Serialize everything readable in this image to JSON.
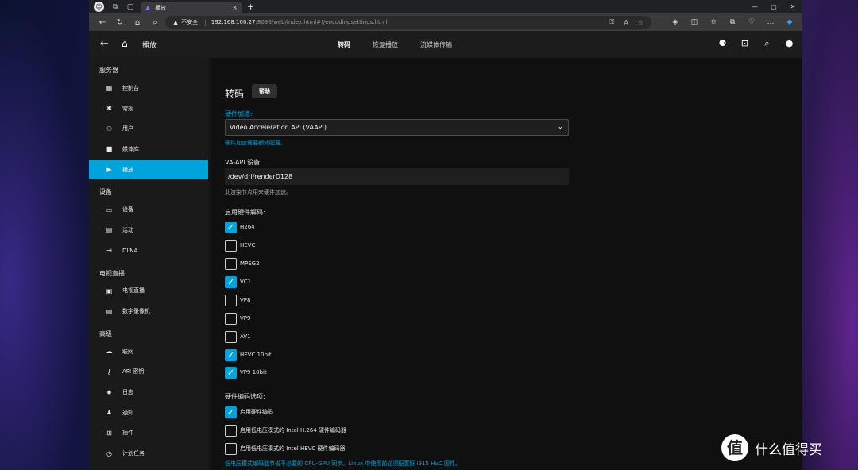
{
  "browser": {
    "tab_title": "播放",
    "new_tab": "+",
    "insecure": "不安全",
    "url_host": "192.168.100.27",
    "url_path": ":8096/web/index.html#!/encodingsettings.html"
  },
  "header": {
    "page_title": "播放",
    "tabs": [
      {
        "label": "转码",
        "active": true
      },
      {
        "label": "恢复播放",
        "active": false
      },
      {
        "label": "流媒体传输",
        "active": false
      }
    ]
  },
  "sidebar": {
    "sections": [
      {
        "title": "服务器",
        "items": [
          {
            "label": "控制台",
            "icon": "dashboard-icon"
          },
          {
            "label": "常规",
            "icon": "gear-icon"
          },
          {
            "label": "用户",
            "icon": "users-icon"
          },
          {
            "label": "媒体库",
            "icon": "folder-icon"
          },
          {
            "label": "播放",
            "icon": "play-icon",
            "active": true
          }
        ]
      },
      {
        "title": "设备",
        "items": [
          {
            "label": "设备",
            "icon": "devices-icon"
          },
          {
            "label": "活动",
            "icon": "activity-icon"
          },
          {
            "label": "DLNA",
            "icon": "dlna-icon"
          }
        ]
      },
      {
        "title": "电视直播",
        "items": [
          {
            "label": "电视直播",
            "icon": "live-tv-icon"
          },
          {
            "label": "数字录像机",
            "icon": "dvr-icon"
          }
        ]
      },
      {
        "title": "高级",
        "items": [
          {
            "label": "联网",
            "icon": "cloud-icon"
          },
          {
            "label": "API 密钥",
            "icon": "key-icon"
          },
          {
            "label": "日志",
            "icon": "bug-icon"
          },
          {
            "label": "通知",
            "icon": "bell-icon"
          },
          {
            "label": "插件",
            "icon": "cart-icon"
          },
          {
            "label": "计划任务",
            "icon": "clock-icon"
          }
        ]
      }
    ]
  },
  "main": {
    "title": "转码",
    "help_button": "帮助",
    "hw_accel_label": "硬件加速:",
    "hw_accel_value": "Video Acceleration API (VAAPI)",
    "hw_accel_note": "硬件加速需要额外配置。",
    "vaapi_label": "VA-API 设备:",
    "vaapi_value": "/dev/dri/renderD128",
    "vaapi_note": "此渲染节点用来硬件加速。",
    "hw_decode_label": "启用硬件解码:",
    "decoders": [
      {
        "label": "H264",
        "checked": true
      },
      {
        "label": "HEVC",
        "checked": false
      },
      {
        "label": "MPEG2",
        "checked": false
      },
      {
        "label": "VC1",
        "checked": true
      },
      {
        "label": "VP8",
        "checked": false
      },
      {
        "label": "VP9",
        "checked": false
      },
      {
        "label": "AV1",
        "checked": false
      },
      {
        "label": "HEVC 10bit",
        "checked": true
      },
      {
        "label": "VP9 10bit",
        "checked": true
      }
    ],
    "hw_encode_label": "硬件编码选项:",
    "encoders": [
      {
        "label": "启用硬件编码",
        "checked": true
      },
      {
        "label": "启用低电压模式的 Intel H.264 硬件编码器",
        "checked": false
      },
      {
        "label": "启用低电压模式的 Intel HEVC 硬件编码器",
        "checked": false
      }
    ],
    "low_power_note": "低电压模式编码能节省不必要的 CPU-GPU 同步。Linux 中使用前必须配置好 i915 HuC 固件。"
  },
  "watermark": {
    "text": "什么值得买",
    "logo": "值"
  },
  "colors": {
    "accent": "#00a4dc",
    "background": "#101010",
    "sidebar": "#1a1a1a"
  }
}
